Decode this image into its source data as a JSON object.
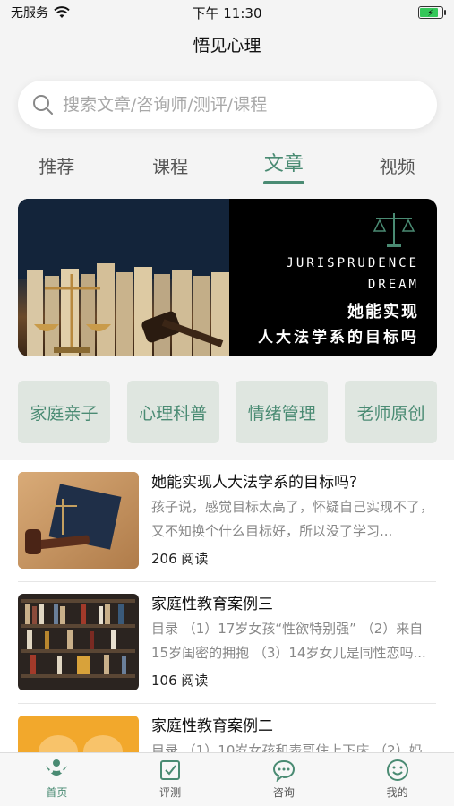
{
  "status": {
    "carrier": "无服务",
    "time": "下午 11:30"
  },
  "nav": {
    "title": "悟见心理"
  },
  "search": {
    "placeholder": "搜索文章/咨询师/测评/课程"
  },
  "tabs": [
    {
      "label": "推荐",
      "active": false
    },
    {
      "label": "课程",
      "active": false
    },
    {
      "label": "文章",
      "active": true
    },
    {
      "label": "视频",
      "active": false
    }
  ],
  "banner": {
    "line1": "JURISPRUDENCE",
    "line2": "DREAM",
    "cn1": "她能实现",
    "cn2": "人大法学系的目标吗"
  },
  "categories": [
    "家庭亲子",
    "心理科普",
    "情绪管理",
    "老师原创"
  ],
  "articles": [
    {
      "title": "她能实现人大法学系的目标吗?",
      "desc": "孩子说，感觉目标太高了，怀疑自己实现不了，又不知换个什么目标好，所以没了学习...",
      "reads": "206 阅读"
    },
    {
      "title": "家庭性教育案例三",
      "desc": "目录 （1）17岁女孩“性欲特别强” （2）来自15岁闺密的拥抱 （3）14岁女儿是同性恋吗...",
      "reads": "106 阅读"
    },
    {
      "title": "家庭性教育案例二",
      "desc": "目录 （1）10岁女孩和表哥住上下床 （2）妈",
      "reads": ""
    }
  ],
  "tabbar": [
    {
      "label": "首页",
      "icon": "home-logo-icon",
      "active": true
    },
    {
      "label": "评测",
      "icon": "checkbox-icon",
      "active": false
    },
    {
      "label": "咨询",
      "icon": "chat-bubble-icon",
      "active": false
    },
    {
      "label": "我的",
      "icon": "smiley-icon",
      "active": false
    }
  ],
  "colors": {
    "accent": "#4a8b73",
    "category_bg": "#dfe6e0"
  }
}
